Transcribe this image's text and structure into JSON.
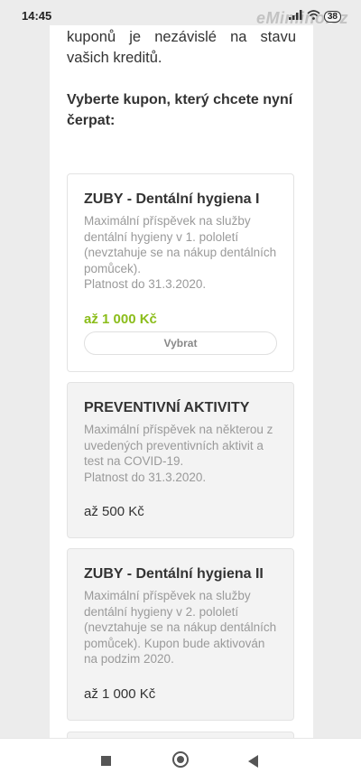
{
  "status": {
    "time": "14:45",
    "watermark": "eMimino.cz",
    "battery": "38"
  },
  "intro_text": "kuponů je nezávislé na stavu vašich kreditů.",
  "prompt_text": "Vyberte kupon, který chcete nyní čerpat:",
  "coupons": [
    {
      "title": "ZUBY - Dentální hygiena I",
      "description": "Maximální příspěvek na služby dentální hygieny v 1. pololetí (nevztahuje se na nákup dentálních pomůcek).",
      "validity": "Platnost do 31.3.2020.",
      "price": "až 1 000 Kč",
      "button": "Vybrat",
      "state": "active"
    },
    {
      "title": "PREVENTIVNÍ AKTIVITY",
      "description": "Maximální příspěvek na některou z uvedených preventivních aktivit a test na COVID-19.",
      "validity": "Platnost do 31.3.2020.",
      "price": "až 500 Kč",
      "state": "inactive"
    },
    {
      "title": "ZUBY - Dentální hygiena II",
      "description": "Maximální příspěvek na služby dentální hygieny v 2. pololetí (nevztahuje se na nákup dentálních pomůcek). Kupon bude aktivován na podzim 2020.",
      "price": "až 1 000 Kč",
      "state": "inactive"
    }
  ],
  "colors": {
    "accent_green": "#8bbd1b",
    "text": "#333333",
    "muted": "#9a9a9a"
  },
  "navbar": {
    "recents_icon": "square-icon",
    "home_icon": "circle-home-icon",
    "back_icon": "triangle-back-icon"
  }
}
